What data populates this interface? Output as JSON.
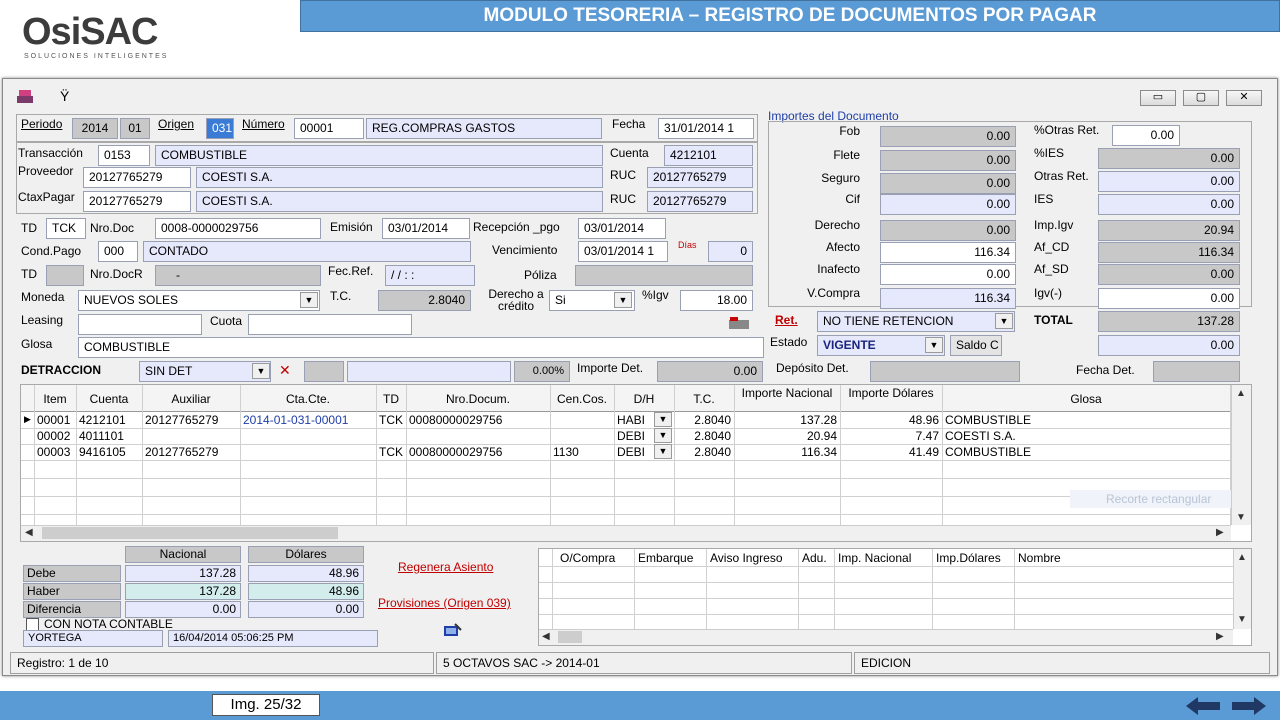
{
  "banner": {
    "title": "MODULO TESORERIA – REGISTRO DE DOCUMENTOS POR PAGAR"
  },
  "logo": {
    "name": "OsiSAC",
    "tagline": "Soluciones Inteligentes"
  },
  "window": {
    "minimize": "▭",
    "restore": "▢",
    "close": "✕"
  },
  "header": {
    "periodo_label": "Periodo",
    "periodo_year": "2014",
    "periodo_month": "01",
    "origen_label": "Origen",
    "origen_value": "031",
    "numero_label": "Número",
    "numero_value": "00001",
    "numero_desc": "REG.COMPRAS GASTOS",
    "fecha_label": "Fecha",
    "fecha_value": "31/01/2014 1"
  },
  "form": {
    "transaccion_label": "Transacción",
    "transaccion_code": "0153",
    "transaccion_desc": "COMBUSTIBLE",
    "cuenta_label": "Cuenta",
    "cuenta_value": "4212101",
    "proveedor_label": "Proveedor",
    "proveedor_code": "20127765279",
    "proveedor_name": "COESTI S.A.",
    "ruc_label": "RUC",
    "ruc_value": "20127765279",
    "ctaxpagar_label": "CtaxPagar",
    "ctaxpagar_code": "20127765279",
    "ctaxpagar_name": "COESTI S.A.",
    "ruc2_label": "RUC",
    "ruc2_value": "20127765279",
    "td_label": "TD",
    "td_value": "TCK",
    "nrodoc_label": "Nro.Doc",
    "nrodoc_value": "0008-0000029756",
    "emision_label": "Emisión",
    "emision_value": "03/01/2014",
    "recepcion_label": "Recepción _pgo",
    "recepcion_value": "03/01/2014",
    "condpago_label": "Cond.Pago",
    "condpago_code": "000",
    "condpago_desc": "CONTADO",
    "vencimiento_label": "Vencimiento",
    "vencimiento_value": "03/01/2014 1",
    "dias_label": "Días",
    "dias_value": "0",
    "td2_label": "TD",
    "nrodocr_label": "Nro.DocR",
    "nrodocr_value": "-",
    "fecref_label": "Fec.Ref.",
    "fecref_value": "/ /      : :",
    "poliza_label": "Póliza",
    "moneda_label": "Moneda",
    "moneda_value": "NUEVOS SOLES",
    "tc_label": "T.C.",
    "tc_value": "2.8040",
    "derecho_label": "Derecho a crédito",
    "derecho_value": "Si",
    "igv_label": "%Igv",
    "igv_value": "18.00",
    "leasing_label": "Leasing",
    "cuota_label": "Cuota",
    "glosa_label": "Glosa",
    "glosa_value": "COMBUSTIBLE",
    "detraccion_label": "DETRACCION",
    "detraccion_value": "SIN DET",
    "detraccion_pct": "0.00%",
    "importe_det_label": "Importe Det.",
    "importe_det_value": "0.00"
  },
  "importes": {
    "title": "Importes del Documento",
    "left": [
      {
        "label": "Fob",
        "value": "0.00",
        "style": "gray"
      },
      {
        "label": "Flete",
        "value": "0.00",
        "style": "gray"
      },
      {
        "label": "Seguro",
        "value": "0.00",
        "style": "gray"
      },
      {
        "label": "Cif",
        "value": "0.00",
        "style": "blue"
      },
      {
        "label": "Derecho",
        "value": "0.00",
        "style": "gray"
      },
      {
        "label": "Afecto",
        "value": "116.34",
        "style": "white"
      },
      {
        "label": "Inafecto",
        "value": "0.00",
        "style": "white"
      },
      {
        "label": "V.Compra",
        "value": "116.34",
        "style": "blue"
      }
    ],
    "right": [
      {
        "label": "%Otras Ret.",
        "value": "0.00",
        "style": "white"
      },
      {
        "label": "%IES",
        "value": "0.00",
        "style": "gray"
      },
      {
        "label": "Otras Ret.",
        "value": "0.00",
        "style": "blue"
      },
      {
        "label": "IES",
        "value": "0.00",
        "style": "blue"
      },
      {
        "label": "Imp.Igv",
        "value": "20.94",
        "style": "gray"
      },
      {
        "label": "Af_CD",
        "value": "116.34",
        "style": "gray"
      },
      {
        "label": "Af_SD",
        "value": "0.00",
        "style": "gray"
      },
      {
        "label": "Igv(-)",
        "value": "0.00",
        "style": "white"
      }
    ],
    "ret_label": "Ret.",
    "ret_value": "NO TIENE RETENCION",
    "total_label": "TOTAL",
    "total_value": "137.28",
    "estado_label": "Estado",
    "estado_value": "VIGENTE",
    "saldo_label": "Saldo C",
    "saldo_value": "0.00",
    "deposito_label": "Depósito Det.",
    "fecha_det_label": "Fecha Det."
  },
  "grid": {
    "columns": [
      "Item",
      "Cuenta",
      "Auxiliar",
      "Cta.Cte.",
      "TD",
      "Nro.Docum.",
      "Cen.Cos.",
      "D/H",
      "T.C.",
      "Importe Nacional",
      "Importe Dólares",
      "Glosa"
    ],
    "rows": [
      [
        "00001",
        "4212101",
        "20127765279",
        "2014-01-031-00001",
        "TCK",
        "00080000029756",
        "",
        "HABI",
        "2.8040",
        "137.28",
        "48.96",
        "COMBUSTIBLE"
      ],
      [
        "00002",
        "4011101",
        "",
        "",
        "",
        "",
        "",
        "DEBI",
        "2.8040",
        "20.94",
        "7.47",
        "COESTI S.A."
      ],
      [
        "00003",
        "9416105",
        "20127765279",
        "",
        "TCK",
        "00080000029756",
        "1130",
        "DEBI",
        "2.8040",
        "116.34",
        "41.49",
        "COMBUSTIBLE"
      ]
    ],
    "ghost_text": "Recorte rectangular"
  },
  "totals": {
    "nacional_label": "Nacional",
    "dolares_label": "Dólares",
    "debe_label": "Debe",
    "debe_nac": "137.28",
    "debe_dol": "48.96",
    "haber_label": "Haber",
    "haber_nac": "137.28",
    "haber_dol": "48.96",
    "dif_label": "Diferencia",
    "dif_nac": "0.00",
    "dif_dol": "0.00",
    "nota_label": "CON NOTA CONTABLE",
    "user": "YORTEGA",
    "timestamp": "16/04/2014 05:06:25 PM"
  },
  "links": {
    "regenera": "Regenera Asiento",
    "provisiones": "Provisiones (Origen 039)"
  },
  "subgrid": {
    "columns": [
      "O/Compra",
      "Embarque",
      "Aviso Ingreso",
      "Adu.",
      "Imp. Nacional",
      "Imp.Dólares",
      "Nombre"
    ]
  },
  "status": {
    "registro": "Registro: 1 de 10",
    "empresa": "5 OCTAVOS SAC -> 2014-01",
    "modo": "EDICION"
  },
  "footer": {
    "img_label": "Img.  25/32"
  },
  "colors": {
    "banner": "#5b9bd5",
    "blue_field": "#e6e8fb",
    "gray_field": "#c8c8c8",
    "link": "#c00000"
  }
}
